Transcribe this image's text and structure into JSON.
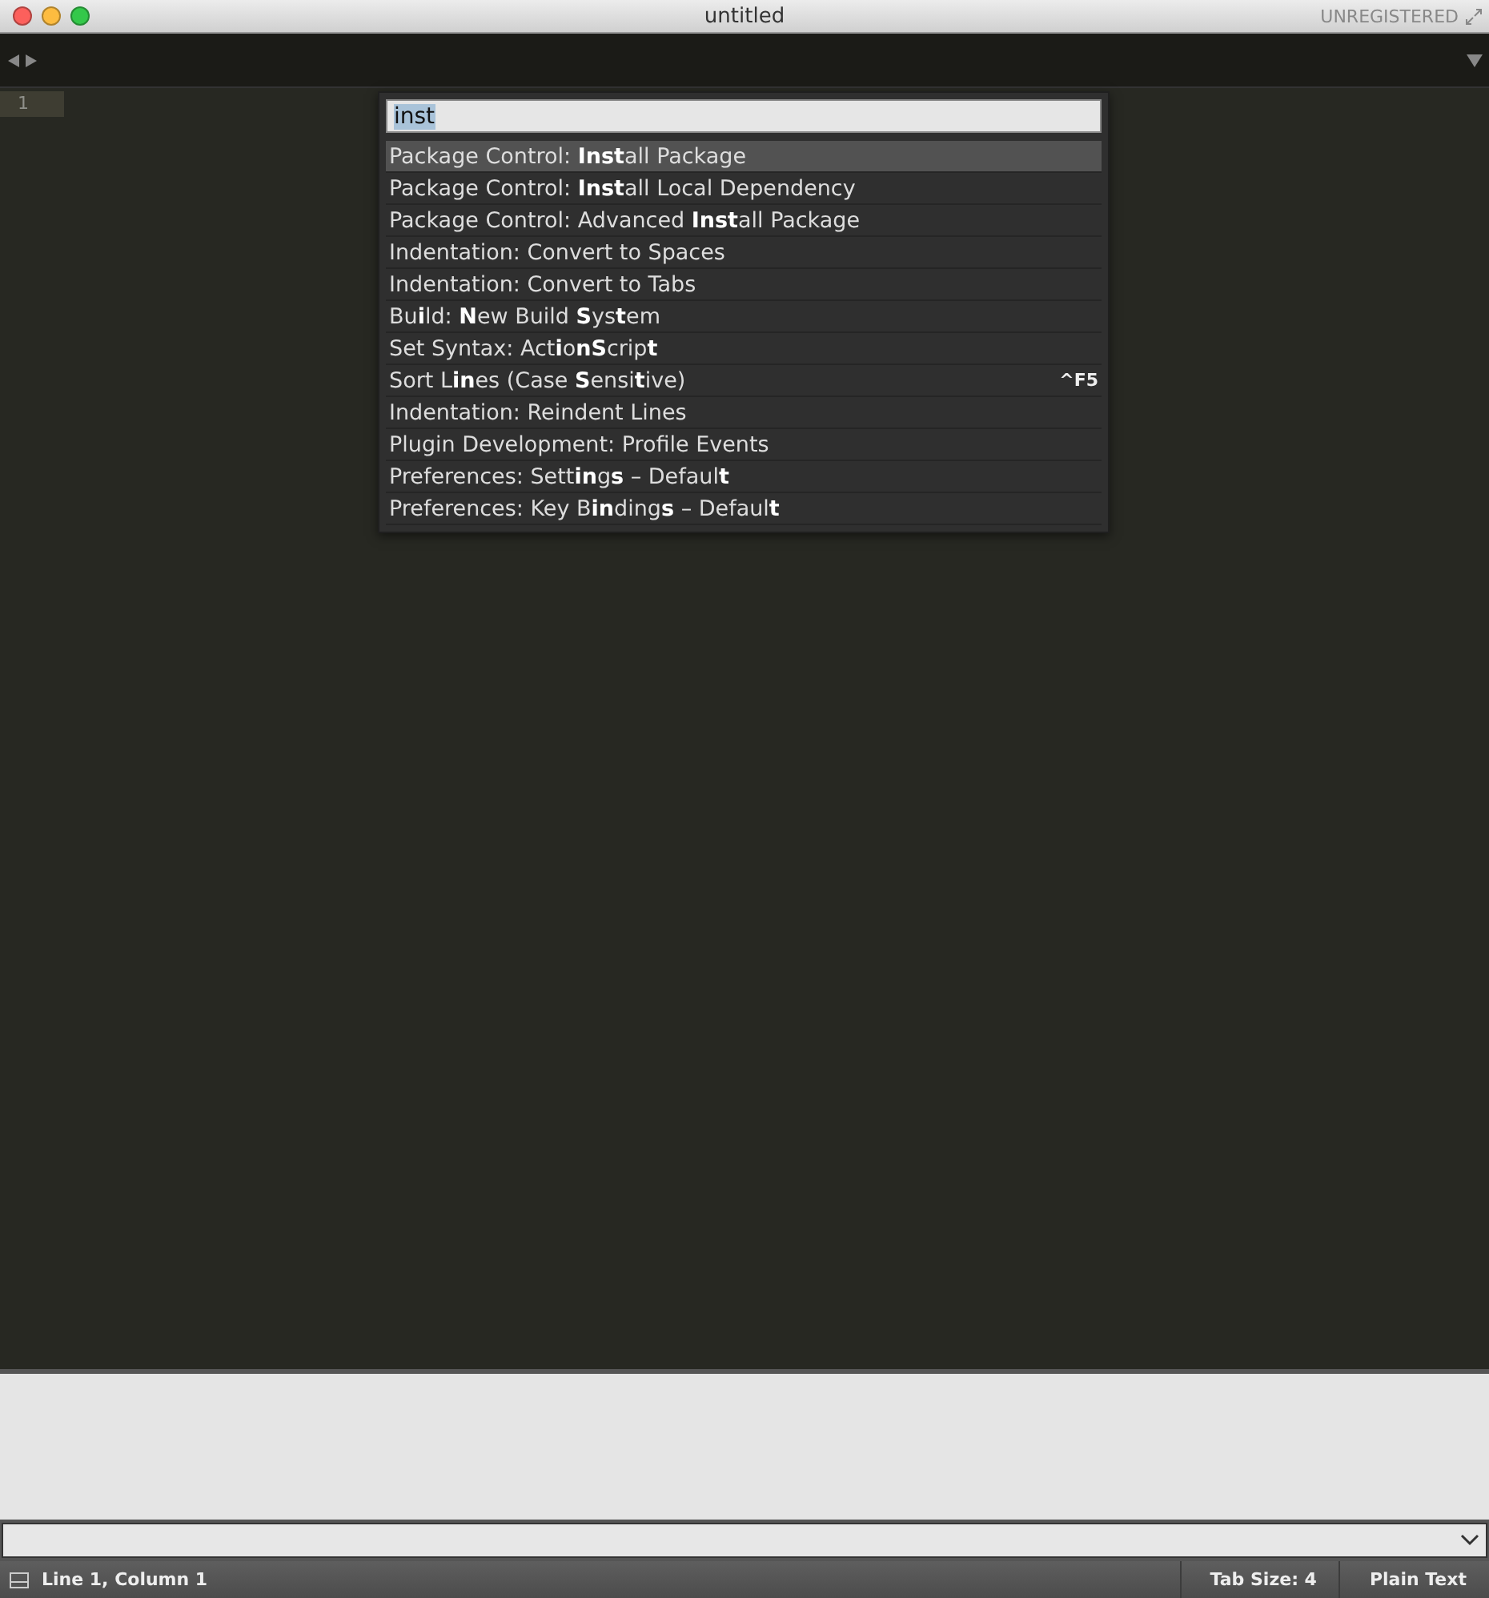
{
  "window": {
    "title": "untitled",
    "registration": "UNREGISTERED"
  },
  "editor": {
    "line_numbers": [
      "1"
    ]
  },
  "command_palette": {
    "query": "inst",
    "items": [
      {
        "label": "Package Control: **Inst**all Package",
        "selected": true
      },
      {
        "label": "Package Control: **Inst**all Local Dependency",
        "selected": false
      },
      {
        "label": "Package Control: Advanced **Inst**all Package",
        "selected": false
      },
      {
        "label": "Indentation: Convert to Spaces",
        "selected": false
      },
      {
        "label": "Indentation: Convert to Tabs",
        "selected": false
      },
      {
        "label": "Bu**i**ld: **N**ew Build **S**ys**t**em",
        "selected": false
      },
      {
        "label": "Set Syntax: Act**i**o**nS**crip**t**",
        "selected": false
      },
      {
        "label": "Sort L**in**es (Case **S**ensi**t**ive)",
        "selected": false,
        "shortcut": "^F5"
      },
      {
        "label": "Indentation: Reindent Lines",
        "selected": false
      },
      {
        "label": "Plugin Development: Profile Events",
        "selected": false
      },
      {
        "label": "Preferences: Sett**in**g**s** – Defaul**t**",
        "selected": false
      },
      {
        "label": "Preferences: Key B**in**ding**s** – Defaul**t**",
        "selected": false
      }
    ]
  },
  "status_bar": {
    "position": "Line 1, Column 1",
    "tab_size": "Tab Size: 4",
    "syntax": "Plain Text"
  }
}
